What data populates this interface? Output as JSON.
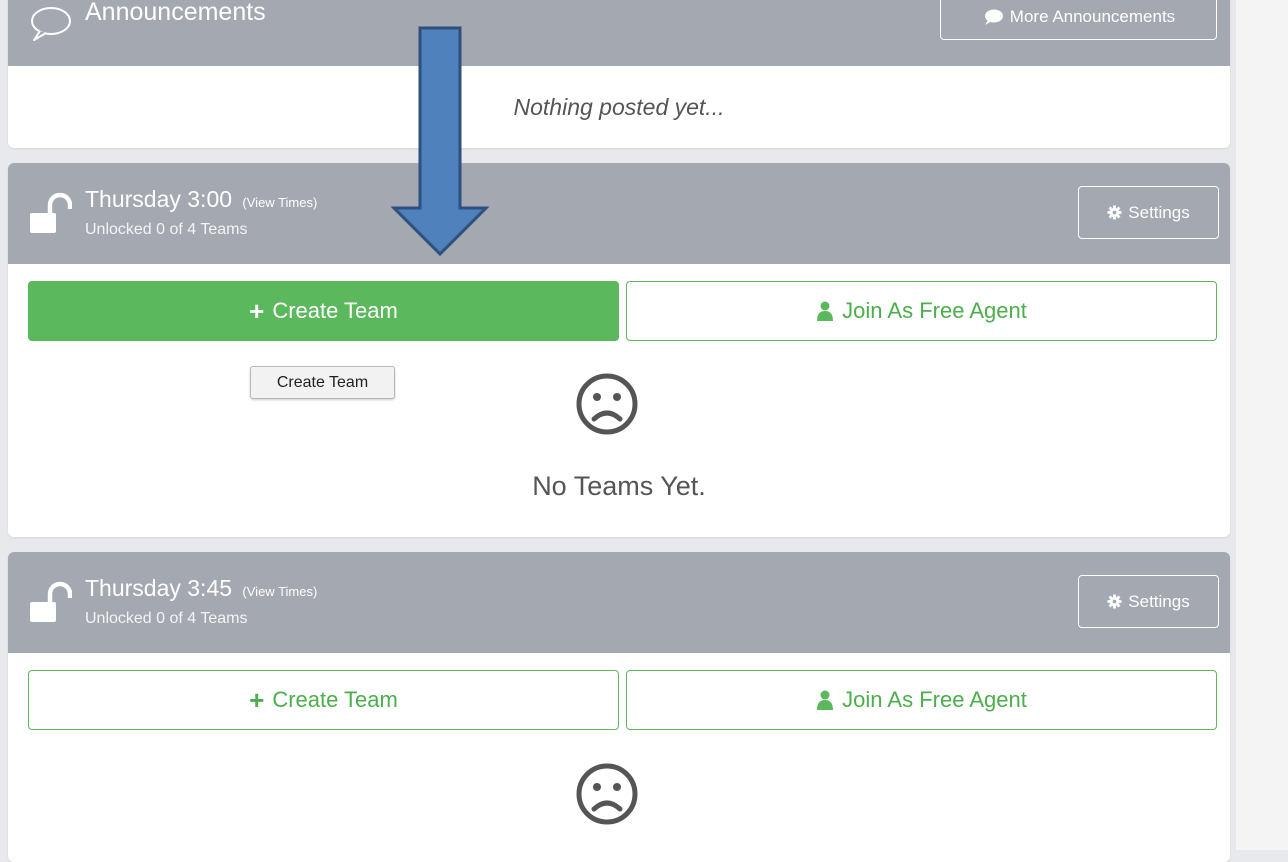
{
  "announcements": {
    "title": "Announcements",
    "more_button": "More Announcements",
    "empty_text": "Nothing posted yet..."
  },
  "slots": [
    {
      "title": "Thursday 3:00",
      "view_times": "(View Times)",
      "subtitle": "Unlocked 0 of 4 Teams",
      "settings_label": "Settings",
      "create_label": "Create Team",
      "join_label": "Join As Free Agent",
      "empty_text": "No Teams Yet."
    },
    {
      "title": "Thursday 3:45",
      "view_times": "(View Times)",
      "subtitle": "Unlocked 0 of 4 Teams",
      "settings_label": "Settings",
      "create_label": "Create Team",
      "join_label": "Join As Free Agent"
    }
  ],
  "tooltip": {
    "text": "Create Team"
  },
  "colors": {
    "header_gray": "#a4a8b1",
    "success_green": "#5cb85c",
    "annotation_arrow": "#4f81bd"
  },
  "icons": [
    "speech-bubble-icon",
    "comment-icon",
    "unlock-icon",
    "gear-icon",
    "plus-icon",
    "user-icon",
    "sad-face-icon",
    "down-arrow-icon"
  ]
}
